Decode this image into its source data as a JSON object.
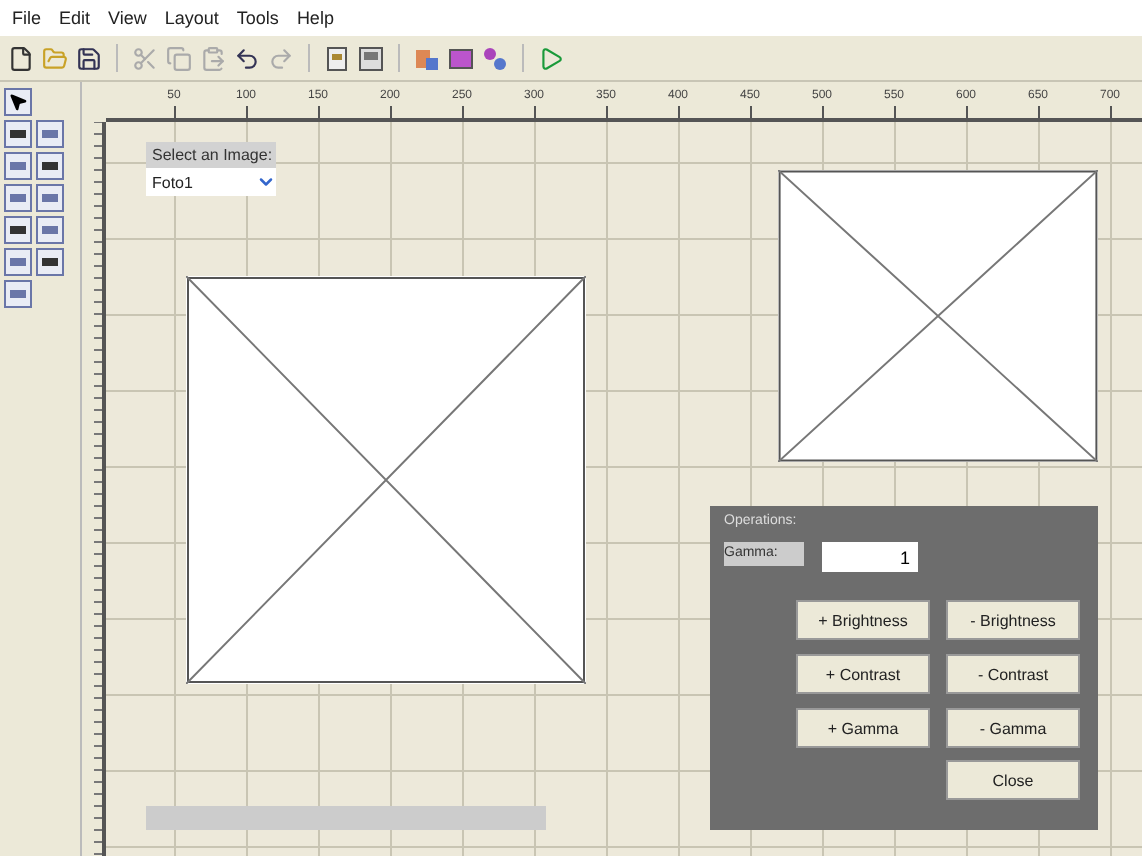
{
  "menu": [
    "File",
    "Edit",
    "View",
    "Layout",
    "Tools",
    "Help"
  ],
  "ruler_labels": [
    "50",
    "100",
    "150",
    "200",
    "250",
    "300",
    "350",
    "400",
    "450",
    "500",
    "550",
    "600",
    "650",
    "700"
  ],
  "canvas": {
    "select_label": "Select an Image:",
    "select_value": "Foto1",
    "operations": {
      "title": "Operations:",
      "gamma_label": "Gamma:",
      "gamma_value": "1",
      "buttons": [
        "+ Brightness",
        "- Brightness",
        "+ Contrast",
        "- Contrast",
        "+ Gamma",
        "- Gamma",
        "Close"
      ]
    }
  }
}
